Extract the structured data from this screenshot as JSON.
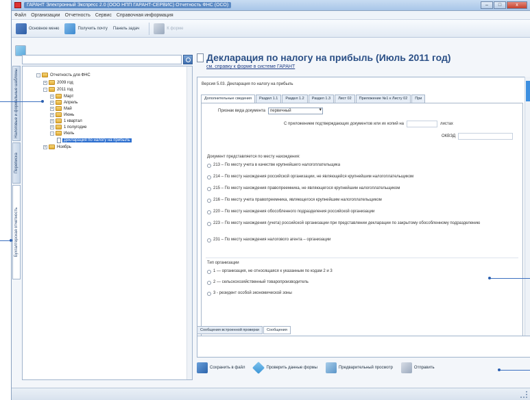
{
  "window": {
    "title": "ГАРАНТ Электронный Экспресс 2.0 (ООО НПП ГАРАНТ-СЕРВИС) Отчетность ФНС (ОСО)",
    "controls": [
      "–",
      "□",
      "x"
    ]
  },
  "menubar": {
    "items": [
      "Файл",
      "Организации",
      "Отчетность",
      "Сервис",
      "Справочная информация"
    ]
  },
  "toolbar": {
    "main_menu": "Основное меню",
    "get_mail": "Получить почту",
    "task_panel": "Панель задач",
    "report": "К форме"
  },
  "vtabs": [
    "Налоговые и формальные шаблоны",
    "Переписка",
    "Бухгалтерская отчетность"
  ],
  "tree": {
    "items": [
      {
        "label": "Отчетность для ФНС",
        "level": 0,
        "type": "folder",
        "exp": "-"
      },
      {
        "label": "2009 год",
        "level": 1,
        "type": "folder",
        "exp": "+"
      },
      {
        "label": "2011 год",
        "level": 1,
        "type": "folder",
        "exp": "-"
      },
      {
        "label": "Март",
        "level": 2,
        "type": "folder",
        "exp": "+"
      },
      {
        "label": "Апрель",
        "level": 2,
        "type": "folder",
        "exp": "+"
      },
      {
        "label": "Май",
        "level": 2,
        "type": "folder",
        "exp": "+"
      },
      {
        "label": "Июнь",
        "level": 2,
        "type": "folder",
        "exp": "+"
      },
      {
        "label": "1 квартал",
        "level": 2,
        "type": "folder",
        "exp": "+"
      },
      {
        "label": "1 полугодие",
        "level": 2,
        "type": "folder",
        "exp": "+"
      },
      {
        "label": "Июль",
        "level": 2,
        "type": "folder",
        "exp": "-"
      },
      {
        "label": "Декларация по налогу на прибыль",
        "level": 3,
        "type": "doc",
        "selected": true
      },
      {
        "label": "Ноябрь",
        "level": 1,
        "type": "folder",
        "exp": "+"
      }
    ]
  },
  "main": {
    "title": "Декларация по налогу на прибыль (Июль 2011 год)",
    "help_link": "см. справку к форме в системе ГАРАНТ",
    "version": "Версия 5.03. Декларация по налогу на прибыль",
    "tabs": [
      "Дополнительные сведения",
      "Раздел 1.1",
      "Раздел 1.2",
      "Раздел 1.3",
      "Лист 02",
      "Приложение №1 к Листу 02",
      "При"
    ],
    "doc_type_label": "Признак вида документа",
    "doc_type_value": "первичный",
    "attach_label": "С приложением подтверждающих документов или их копий на",
    "attach_suffix": "листах",
    "okved_label": "ОКВЭД",
    "location_label": "Документ представляется по месту нахождения:",
    "location_options": [
      "213 – По месту учета в качестве крупнейшего налогоплательщика",
      "214 – По месту нахождения российской организации, не являющейся крупнейшим налогоплательщиком",
      "215 – По месту нахождения правопреемника, не являющегося крупнейшим налогоплательщиком",
      "216 – По месту учета правопреемника, являющегося крупнейшим налогоплательщиком",
      "220 – По месту нахождения обособленного подразделения российской организации",
      "223 – По месту нахождения (учета) российской организации при представлении декларации по закрытому обособленному подразделению",
      "231 – По месту нахождения налогового агента – организации"
    ],
    "org_type_label": "Тип организации",
    "org_type_options": [
      "1 — организация, не относящаяся к указанным по кодам 2 и 3",
      "2 — сельскохозяйственный товаропроизводитель",
      "3 - резидент особой экономической зоны"
    ]
  },
  "bottom": {
    "tabs": [
      "Сообщения встроенной проверки",
      "Сообщения"
    ],
    "save": "Сохранить в файл",
    "check": "Проверить данные формы",
    "preview": "Предварительный просмотр",
    "send": "Отправить"
  },
  "colors": {
    "title": "#2a4f86",
    "selection": "#2b6ecf",
    "callout": "#3a6fbf"
  }
}
